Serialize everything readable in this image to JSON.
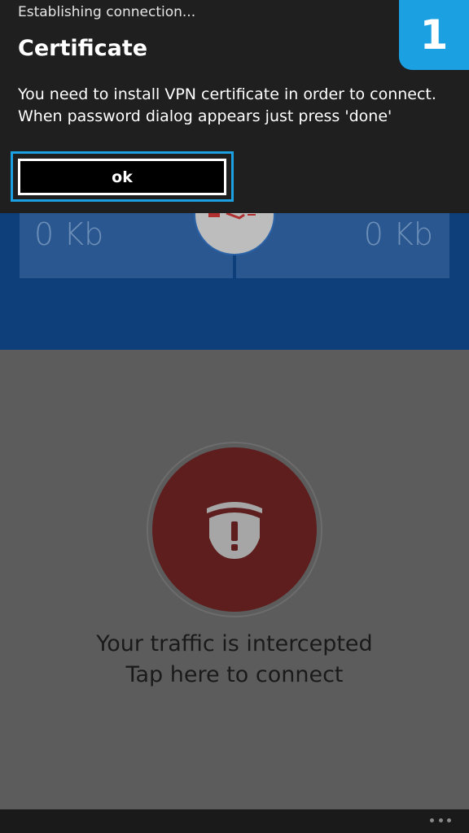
{
  "dialog": {
    "status_text": "Establishing connection...",
    "badge": "1",
    "title": "Certificate",
    "message_lines": [
      "You need to install VPN certificate in order to connect.",
      "When password dialog appears just press 'done'"
    ],
    "ok_label": "ok"
  },
  "stats": {
    "download": "0 Kb",
    "upload": "0 Kb"
  },
  "main": {
    "status_line1": "Your traffic is intercepted",
    "status_line2": "Tap here to connect"
  },
  "icons": {
    "connect": "shield-alert-icon",
    "more": "more-icon"
  },
  "colors": {
    "accent": "#1ba1e2",
    "danger": "#5e1e1e",
    "panel": "#0f3f7a"
  }
}
